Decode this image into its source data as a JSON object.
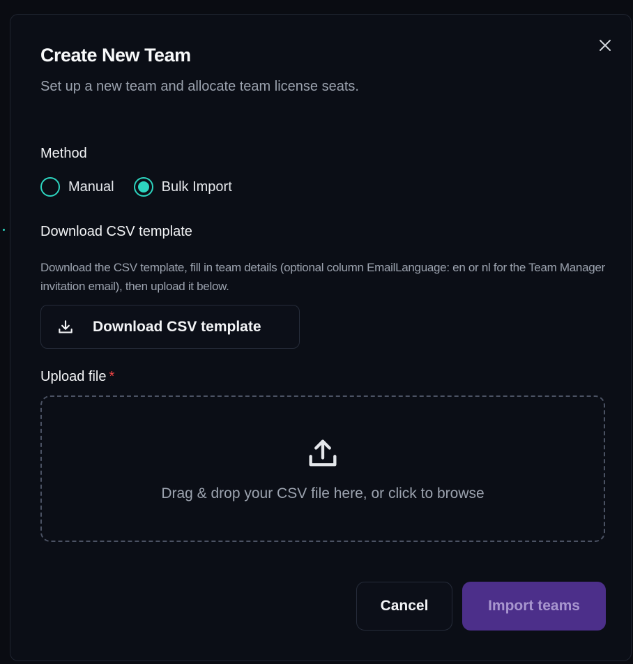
{
  "dialog": {
    "title": "Create New Team",
    "subtitle": "Set up a new team and allocate team license seats.",
    "close_icon": "close-icon"
  },
  "method": {
    "label": "Method",
    "options": [
      {
        "label": "Manual",
        "selected": false
      },
      {
        "label": "Bulk Import",
        "selected": true
      }
    ]
  },
  "csv": {
    "heading": "Download CSV template",
    "description": "Download the CSV template, fill in team details (optional column EmailLanguage: en or nl for the Team Manager invitation email), then upload it below.",
    "download_button_label": "Download CSV template",
    "download_icon": "download-icon"
  },
  "upload": {
    "label": "Upload file",
    "required_marker": "*",
    "dropzone_hint": "Drag & drop your CSV file here, or click to browse",
    "upload_icon": "upload-icon"
  },
  "footer": {
    "cancel_label": "Cancel",
    "import_label": "Import teams"
  },
  "colors": {
    "accent": "#2dd4bf",
    "primary_button": "#4c2f8a",
    "required": "#ef4444",
    "background": "#0b0e16"
  }
}
